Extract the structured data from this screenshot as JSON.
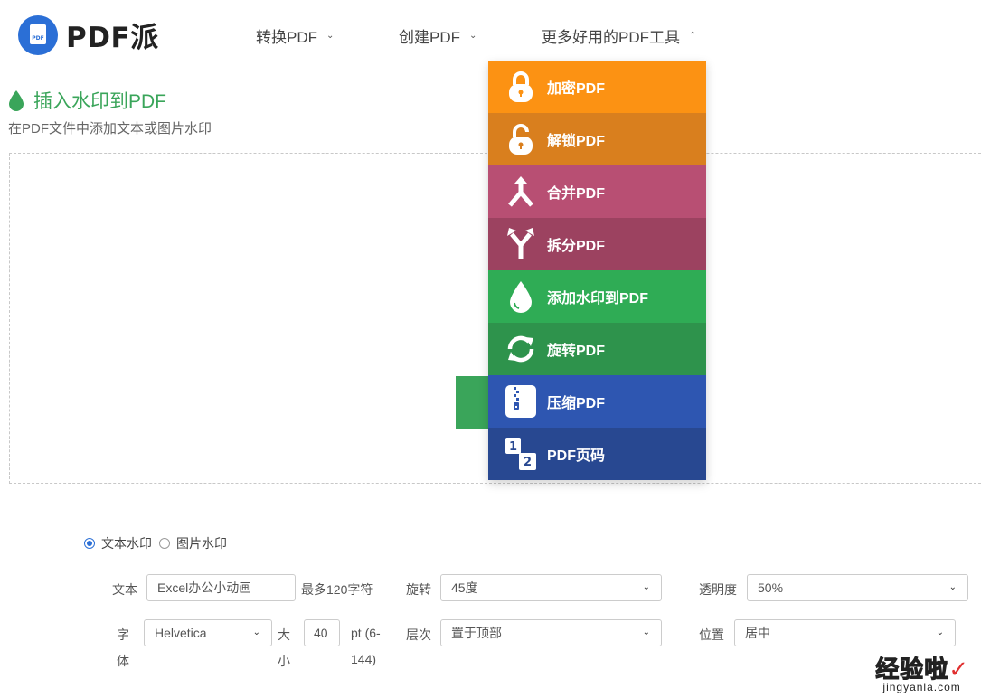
{
  "header": {
    "logo_badge": "PDF",
    "logo_text": "PDF派",
    "nav": [
      {
        "label": "转换PDF",
        "chevron": "chevron-down"
      },
      {
        "label": "创建PDF",
        "chevron": "chevron-down"
      },
      {
        "label": "更多好用的PDF工具",
        "chevron": "chevron-up"
      }
    ]
  },
  "page": {
    "title": "插入水印到PDF",
    "subtitle": "在PDF文件中添加文本或图片水印",
    "accent": "#3aa55a"
  },
  "dropdown": {
    "items": [
      {
        "label": "加密PDF",
        "icon": "lock-icon",
        "color": "#fc9213"
      },
      {
        "label": "解锁PDF",
        "icon": "unlock-icon",
        "color": "#d97f1e"
      },
      {
        "label": "合并PDF",
        "icon": "merge-icon",
        "color": "#b84f73"
      },
      {
        "label": "拆分PDF",
        "icon": "split-icon",
        "color": "#9c4260"
      },
      {
        "label": "添加水印到PDF",
        "icon": "water-drop-icon",
        "color": "#2fac55"
      },
      {
        "label": "旋转PDF",
        "icon": "rotate-icon",
        "color": "#2e934c"
      },
      {
        "label": "压缩PDF",
        "icon": "zip-icon",
        "color": "#2e56b1"
      },
      {
        "label": "PDF页码",
        "icon": "page-number-icon",
        "color": "#284891"
      }
    ]
  },
  "options": {
    "radio_text": "文本水印",
    "radio_image": "图片水印",
    "text_label": "文本",
    "text_value": "Excel办公小动画",
    "text_hint": "最多120字符",
    "rotate_label": "旋转",
    "rotate_value": "45度",
    "opacity_label": "透明度",
    "opacity_value": "50%",
    "font_label_1": "字",
    "font_label_2": "体",
    "font_value": "Helvetica",
    "size_label_1": "大",
    "size_label_2": "小",
    "size_value": "40",
    "size_hint_1": "pt (6-",
    "size_hint_2": "144)",
    "layer_label": "层次",
    "layer_value": "置于顶部",
    "position_label": "位置",
    "position_value": "居中"
  },
  "watermark": {
    "main": "经验啦",
    "check": "✓",
    "sub": "jingyanla.com"
  }
}
